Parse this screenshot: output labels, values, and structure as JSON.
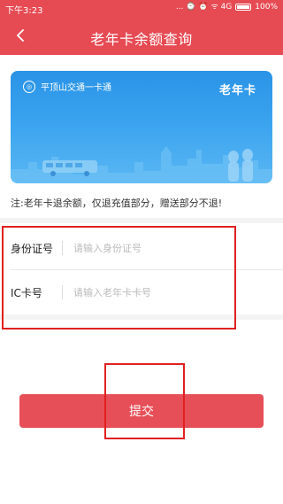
{
  "status_bar": {
    "time": "下午3:23",
    "indicators": "... ⌚ ⏰ ᯤ 4G",
    "battery": "100%"
  },
  "header": {
    "title": "老年卡余额查询",
    "back_icon": "chevron-left-icon"
  },
  "card": {
    "issuer": "平顶山交通一卡通",
    "card_type": "老年卡"
  },
  "notice": "注:老年卡退余额，仅退充值部分，赠送部分不退!",
  "form": {
    "id_label": "身份证号",
    "id_placeholder": "请输入身份证号",
    "ic_label": "IC卡号",
    "ic_placeholder": "请输入老年卡卡号"
  },
  "submit_label": "提交",
  "colors": {
    "brand_red": "#e64a53",
    "card_blue": "#2a93e6",
    "highlight": "#e02020"
  }
}
